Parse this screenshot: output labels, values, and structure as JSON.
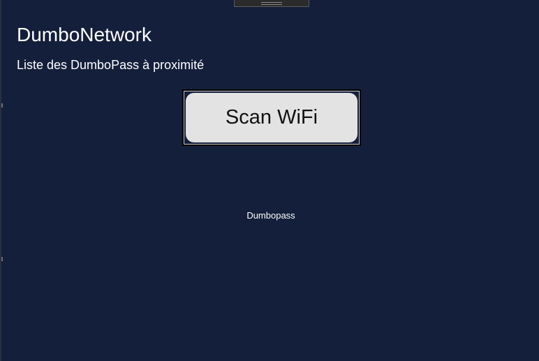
{
  "app": {
    "title": "DumboNetwork",
    "subtitle": "Liste des DumboPass à proximité"
  },
  "actions": {
    "scan_label": "Scan WiFi"
  },
  "results": {
    "items": [
      "Dumbopass"
    ]
  },
  "colors": {
    "background": "#141f3b",
    "button_face": "#e3e3e3",
    "text": "#ffffff"
  }
}
